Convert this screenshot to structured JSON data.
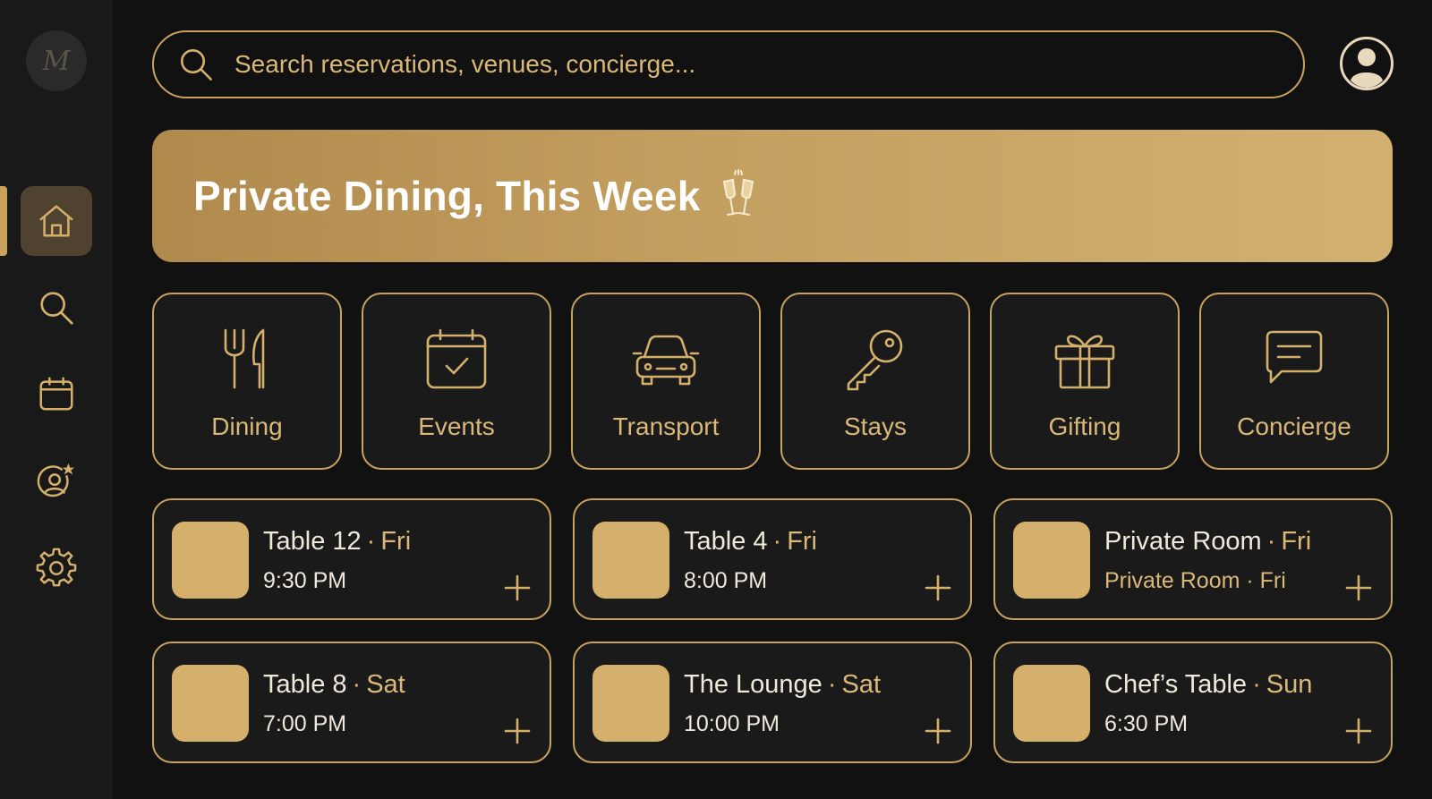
{
  "sidebar": {
    "logo_text": "M",
    "items": [
      {
        "name": "home",
        "icon": "home-icon",
        "active": true
      },
      {
        "name": "search",
        "icon": "search-icon",
        "active": false
      },
      {
        "name": "calendar",
        "icon": "calendar-icon",
        "active": false
      },
      {
        "name": "favorites",
        "icon": "profile-star-icon",
        "active": false
      },
      {
        "name": "settings",
        "icon": "gear-icon",
        "active": false
      }
    ]
  },
  "search": {
    "placeholder": "Search reservations, venues, concierge..."
  },
  "banner": {
    "title": "Private Dining, This Week",
    "icon": "champagne-toast-icon"
  },
  "categories": [
    {
      "label": "Dining",
      "icon": "fork-knife-icon"
    },
    {
      "label": "Events",
      "icon": "calendar-check-icon"
    },
    {
      "label": "Transport",
      "icon": "car-icon"
    },
    {
      "label": "Stays",
      "icon": "key-icon"
    },
    {
      "label": "Gifting",
      "icon": "gift-icon"
    },
    {
      "label": "Concierge",
      "icon": "chat-icon"
    }
  ],
  "bookings": [
    {
      "title": "Table 12",
      "sep": "·",
      "day": "Fri",
      "sub": "9:30 PM"
    },
    {
      "title": "Table 4",
      "sep": "·",
      "day": "Fri",
      "sub": "8:00 PM"
    },
    {
      "title": "Private Room",
      "sep": "·",
      "day": "Fri",
      "sub": "Private Room · Fri"
    },
    {
      "title": "Table 8",
      "sep": "·",
      "day": "Sat",
      "sub": "7:00 PM"
    },
    {
      "title": "The Lounge",
      "sep": "·",
      "day": "Sat",
      "sub": "10:00 PM"
    },
    {
      "title": "Chef’s Table",
      "sep": "·",
      "day": "Sun",
      "sub": "6:30 PM"
    }
  ],
  "colors": {
    "accent": "#c9a35e",
    "accent_text": "#d9b878",
    "background": "#111111",
    "sidebar": "#191919",
    "card": "#1a1a1a",
    "thumb": "#d4b06c"
  }
}
